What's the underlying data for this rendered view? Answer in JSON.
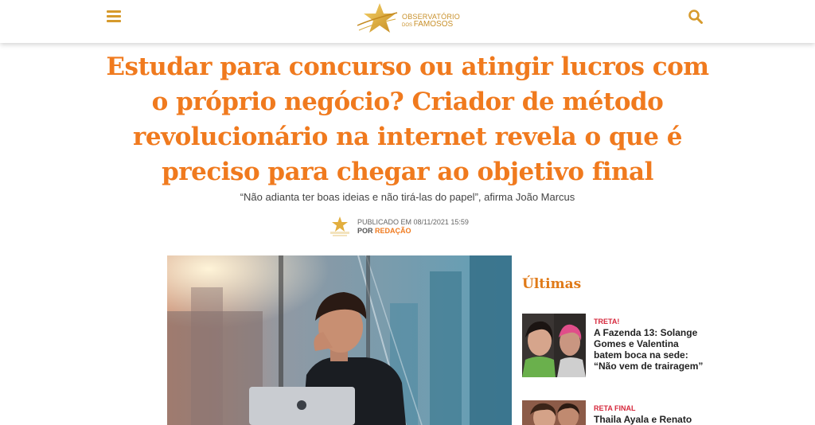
{
  "header": {
    "menu_icon": "hamburger-menu-icon",
    "logo_line1": "OBSERVATÓRIO",
    "logo_line2_small": "DOS",
    "logo_line2_big": "FAMOSOS",
    "search_icon": "search-icon",
    "accent_color": "#d69a2c"
  },
  "article": {
    "title": "Estudar para concurso ou atingir lucros com o próprio negócio? Criador de método revolucionário na internet revela o que é preciso para chegar ao objetivo final",
    "subtitle": "“Não adianta ter boas ideias e não tirá-las do papel”, afirma João Marcus",
    "published_label": "PUBLICADO EM 08/11/2021 15:59",
    "by_label": "POR",
    "author": "REDAÇÃO",
    "title_color": "#f07a1e"
  },
  "sidebar": {
    "title": "Últimas",
    "items": [
      {
        "category": "TRETA!",
        "title": "A Fazenda 13: Solange Gomes e Valentina batem boca na sede: “Não vem de trairagem”"
      },
      {
        "category": "RETA FINAL",
        "title": "Thaila Ayala e Renato"
      }
    ]
  }
}
